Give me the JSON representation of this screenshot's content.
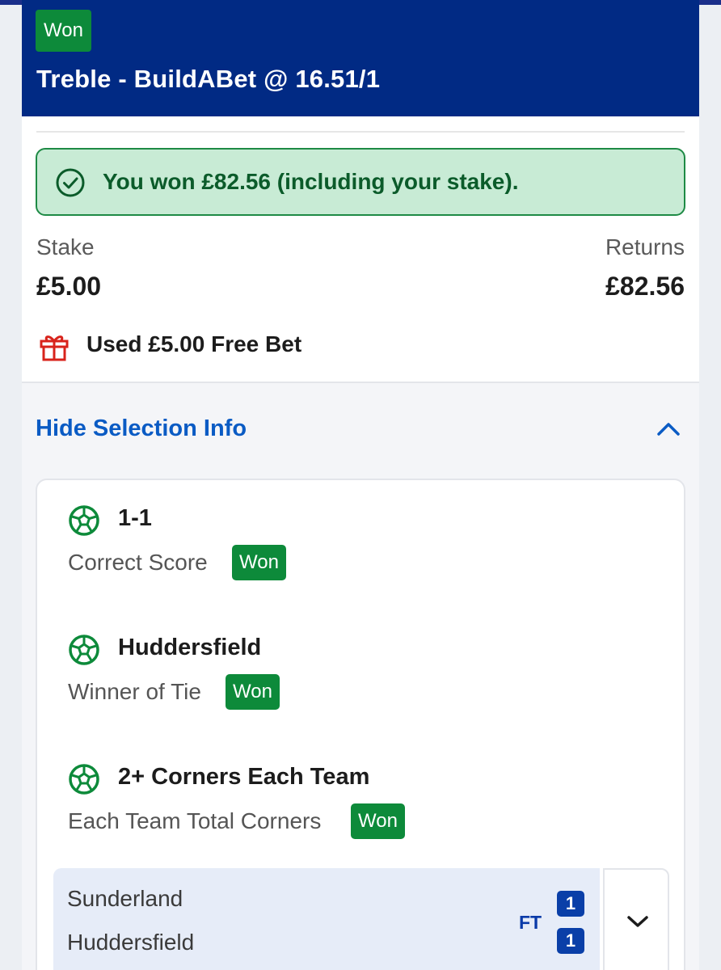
{
  "header": {
    "status_badge": "Won",
    "bet_title": "Treble - BuildABet @ 16.51/1"
  },
  "win_banner": {
    "text": "You won £82.56 (including your stake)."
  },
  "summary": {
    "stake_label": "Stake",
    "stake_value": "£5.00",
    "returns_label": "Returns",
    "returns_value": "£82.56",
    "free_bet_text": "Used £5.00 Free Bet"
  },
  "selection_info": {
    "toggle_label": "Hide Selection Info",
    "selections": [
      {
        "name": "1-1",
        "market": "Correct Score",
        "result": "Won"
      },
      {
        "name": "Huddersfield",
        "market": "Winner of Tie",
        "result": "Won"
      },
      {
        "name": "2+ Corners Each Team",
        "market": "Each Team Total Corners",
        "result": "Won"
      }
    ],
    "event": {
      "home_team": "Sunderland",
      "away_team": "Huddersfield",
      "status": "FT",
      "home_score": "1",
      "away_score": "1"
    }
  },
  "colors": {
    "header_bg": "#012a84",
    "won_green": "#0d8a3a",
    "banner_bg": "#c8ebd5",
    "link_blue": "#0a5bc4",
    "gift_red": "#d8231b"
  },
  "icons": [
    "check-circle-icon",
    "gift-icon",
    "chevron-up-icon",
    "football-icon",
    "chevron-down-icon"
  ]
}
